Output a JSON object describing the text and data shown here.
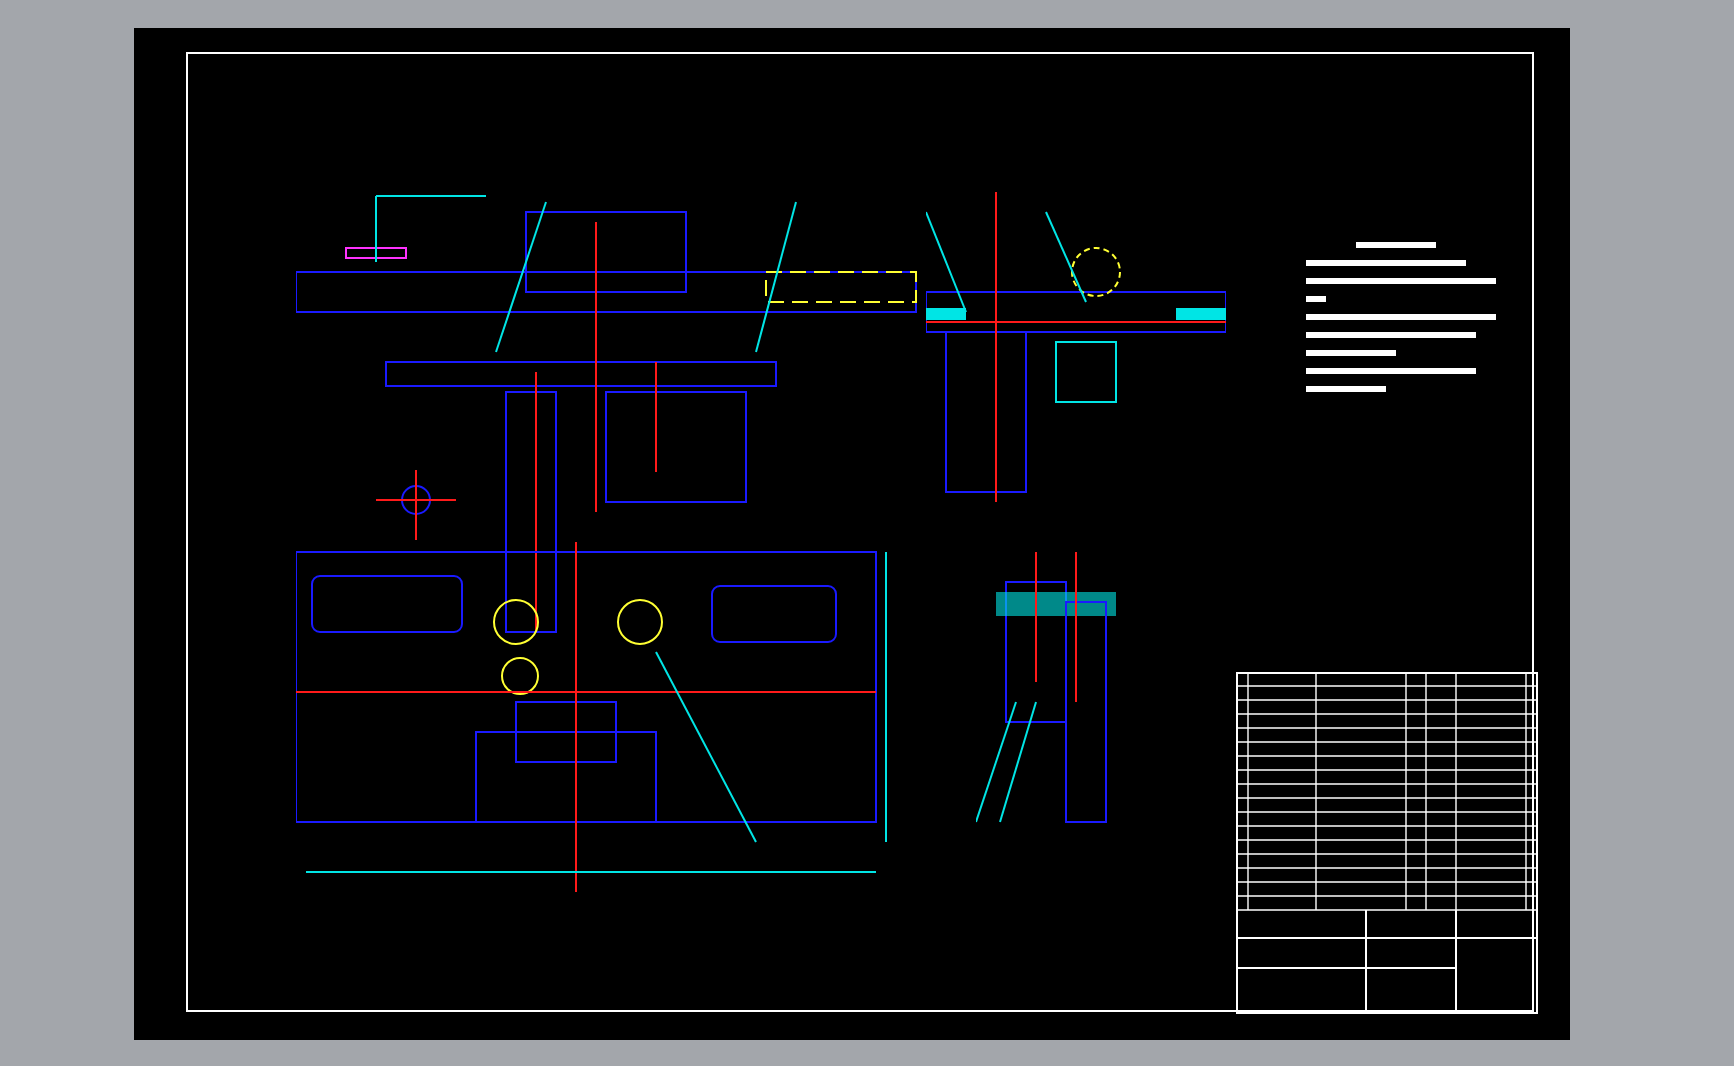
{
  "drawing": {
    "views": [
      {
        "kind": "elevation"
      },
      {
        "kind": "plan"
      },
      {
        "kind": "side"
      },
      {
        "kind": "section"
      },
      {
        "kind": "detail"
      }
    ],
    "notes": {
      "kind": "notes"
    },
    "title_block": {
      "kind": "parts-list"
    }
  }
}
